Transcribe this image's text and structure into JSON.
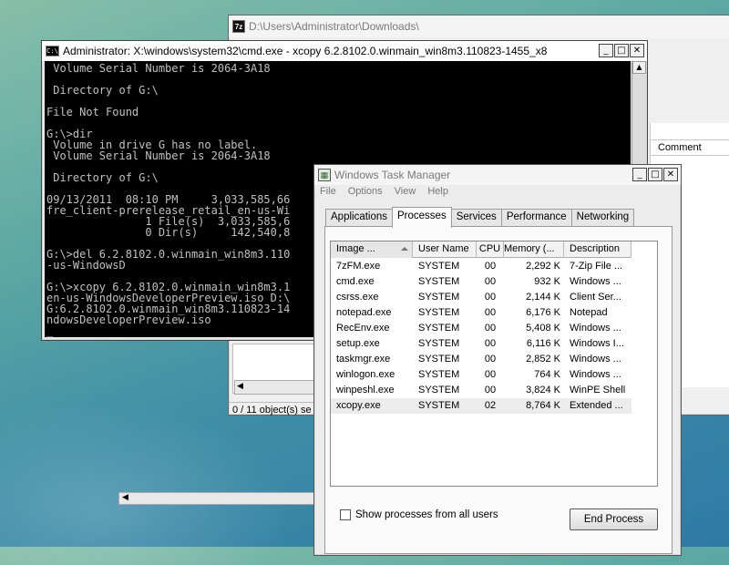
{
  "explorer": {
    "title": "D:\\Users\\Administrator\\Downloads\\",
    "column_comment": "Comment",
    "status": "0 / 11 object(s) se"
  },
  "cmd": {
    "title": "Administrator: X:\\windows\\system32\\cmd.exe - xcopy  6.2.8102.0.winmain_win8m3.110823-1455_x8",
    "icon_text": "C:\\",
    "lines": [
      " Volume Serial Number is 2064-3A18",
      "",
      " Directory of G:\\",
      "",
      "File Not Found",
      "",
      "G:\\>dir",
      " Volume in drive G has no label.",
      " Volume Serial Number is 2064-3A18",
      "",
      " Directory of G:\\",
      "",
      "09/13/2011  08:10 PM     3,033,585,66",
      "fre_client-prerelease_retail_en-us-Wi",
      "               1 File(s)  3,033,585,6",
      "               0 Dir(s)     142,540,8",
      "",
      "G:\\>del 6.2.8102.0.winmain_win8m3.110",
      "-us-WindowsD",
      "",
      "G:\\>xcopy 6.2.8102.0.winmain_win8m3.1",
      "en-us-WindowsDeveloperPreview.iso D:\\",
      "G:6.2.8102.0.winmain_win8m3.110823-14",
      "ndowsDeveloperPreview.iso",
      "_"
    ]
  },
  "taskmgr": {
    "title": "Windows Task Manager",
    "menu": [
      "File",
      "Options",
      "View",
      "Help"
    ],
    "tabs": [
      "Applications",
      "Processes",
      "Services",
      "Performance",
      "Networking"
    ],
    "selected_tab": "Processes",
    "columns": [
      "Image ...",
      "User Name",
      "CPU",
      "Memory (...",
      "Description"
    ],
    "processes": [
      {
        "image": "7zFM.exe",
        "user": "SYSTEM",
        "cpu": "00",
        "mem": "2,292 K",
        "desc": "7-Zip File ..."
      },
      {
        "image": "cmd.exe",
        "user": "SYSTEM",
        "cpu": "00",
        "mem": "932 K",
        "desc": "Windows ..."
      },
      {
        "image": "csrss.exe",
        "user": "SYSTEM",
        "cpu": "00",
        "mem": "2,144 K",
        "desc": "Client Ser..."
      },
      {
        "image": "notepad.exe",
        "user": "SYSTEM",
        "cpu": "00",
        "mem": "6,176 K",
        "desc": "Notepad"
      },
      {
        "image": "RecEnv.exe",
        "user": "SYSTEM",
        "cpu": "00",
        "mem": "5,408 K",
        "desc": "Windows ..."
      },
      {
        "image": "setup.exe",
        "user": "SYSTEM",
        "cpu": "00",
        "mem": "6,116 K",
        "desc": "Windows I..."
      },
      {
        "image": "taskmgr.exe",
        "user": "SYSTEM",
        "cpu": "00",
        "mem": "2,852 K",
        "desc": "Windows ..."
      },
      {
        "image": "winlogon.exe",
        "user": "SYSTEM",
        "cpu": "00",
        "mem": "764 K",
        "desc": "Windows ..."
      },
      {
        "image": "winpeshl.exe",
        "user": "SYSTEM",
        "cpu": "00",
        "mem": "3,824 K",
        "desc": "WinPE Shell"
      },
      {
        "image": "xcopy.exe",
        "user": "SYSTEM",
        "cpu": "02",
        "mem": "8,764 K",
        "desc": "Extended ..."
      }
    ],
    "show_all_label": "Show processes from all users",
    "end_process_label": "End Process"
  },
  "icons": {
    "minimize": "minimize-icon",
    "maximize": "maximize-icon",
    "close": "close-icon",
    "resize_cursor": "resize-vertical-cursor"
  }
}
